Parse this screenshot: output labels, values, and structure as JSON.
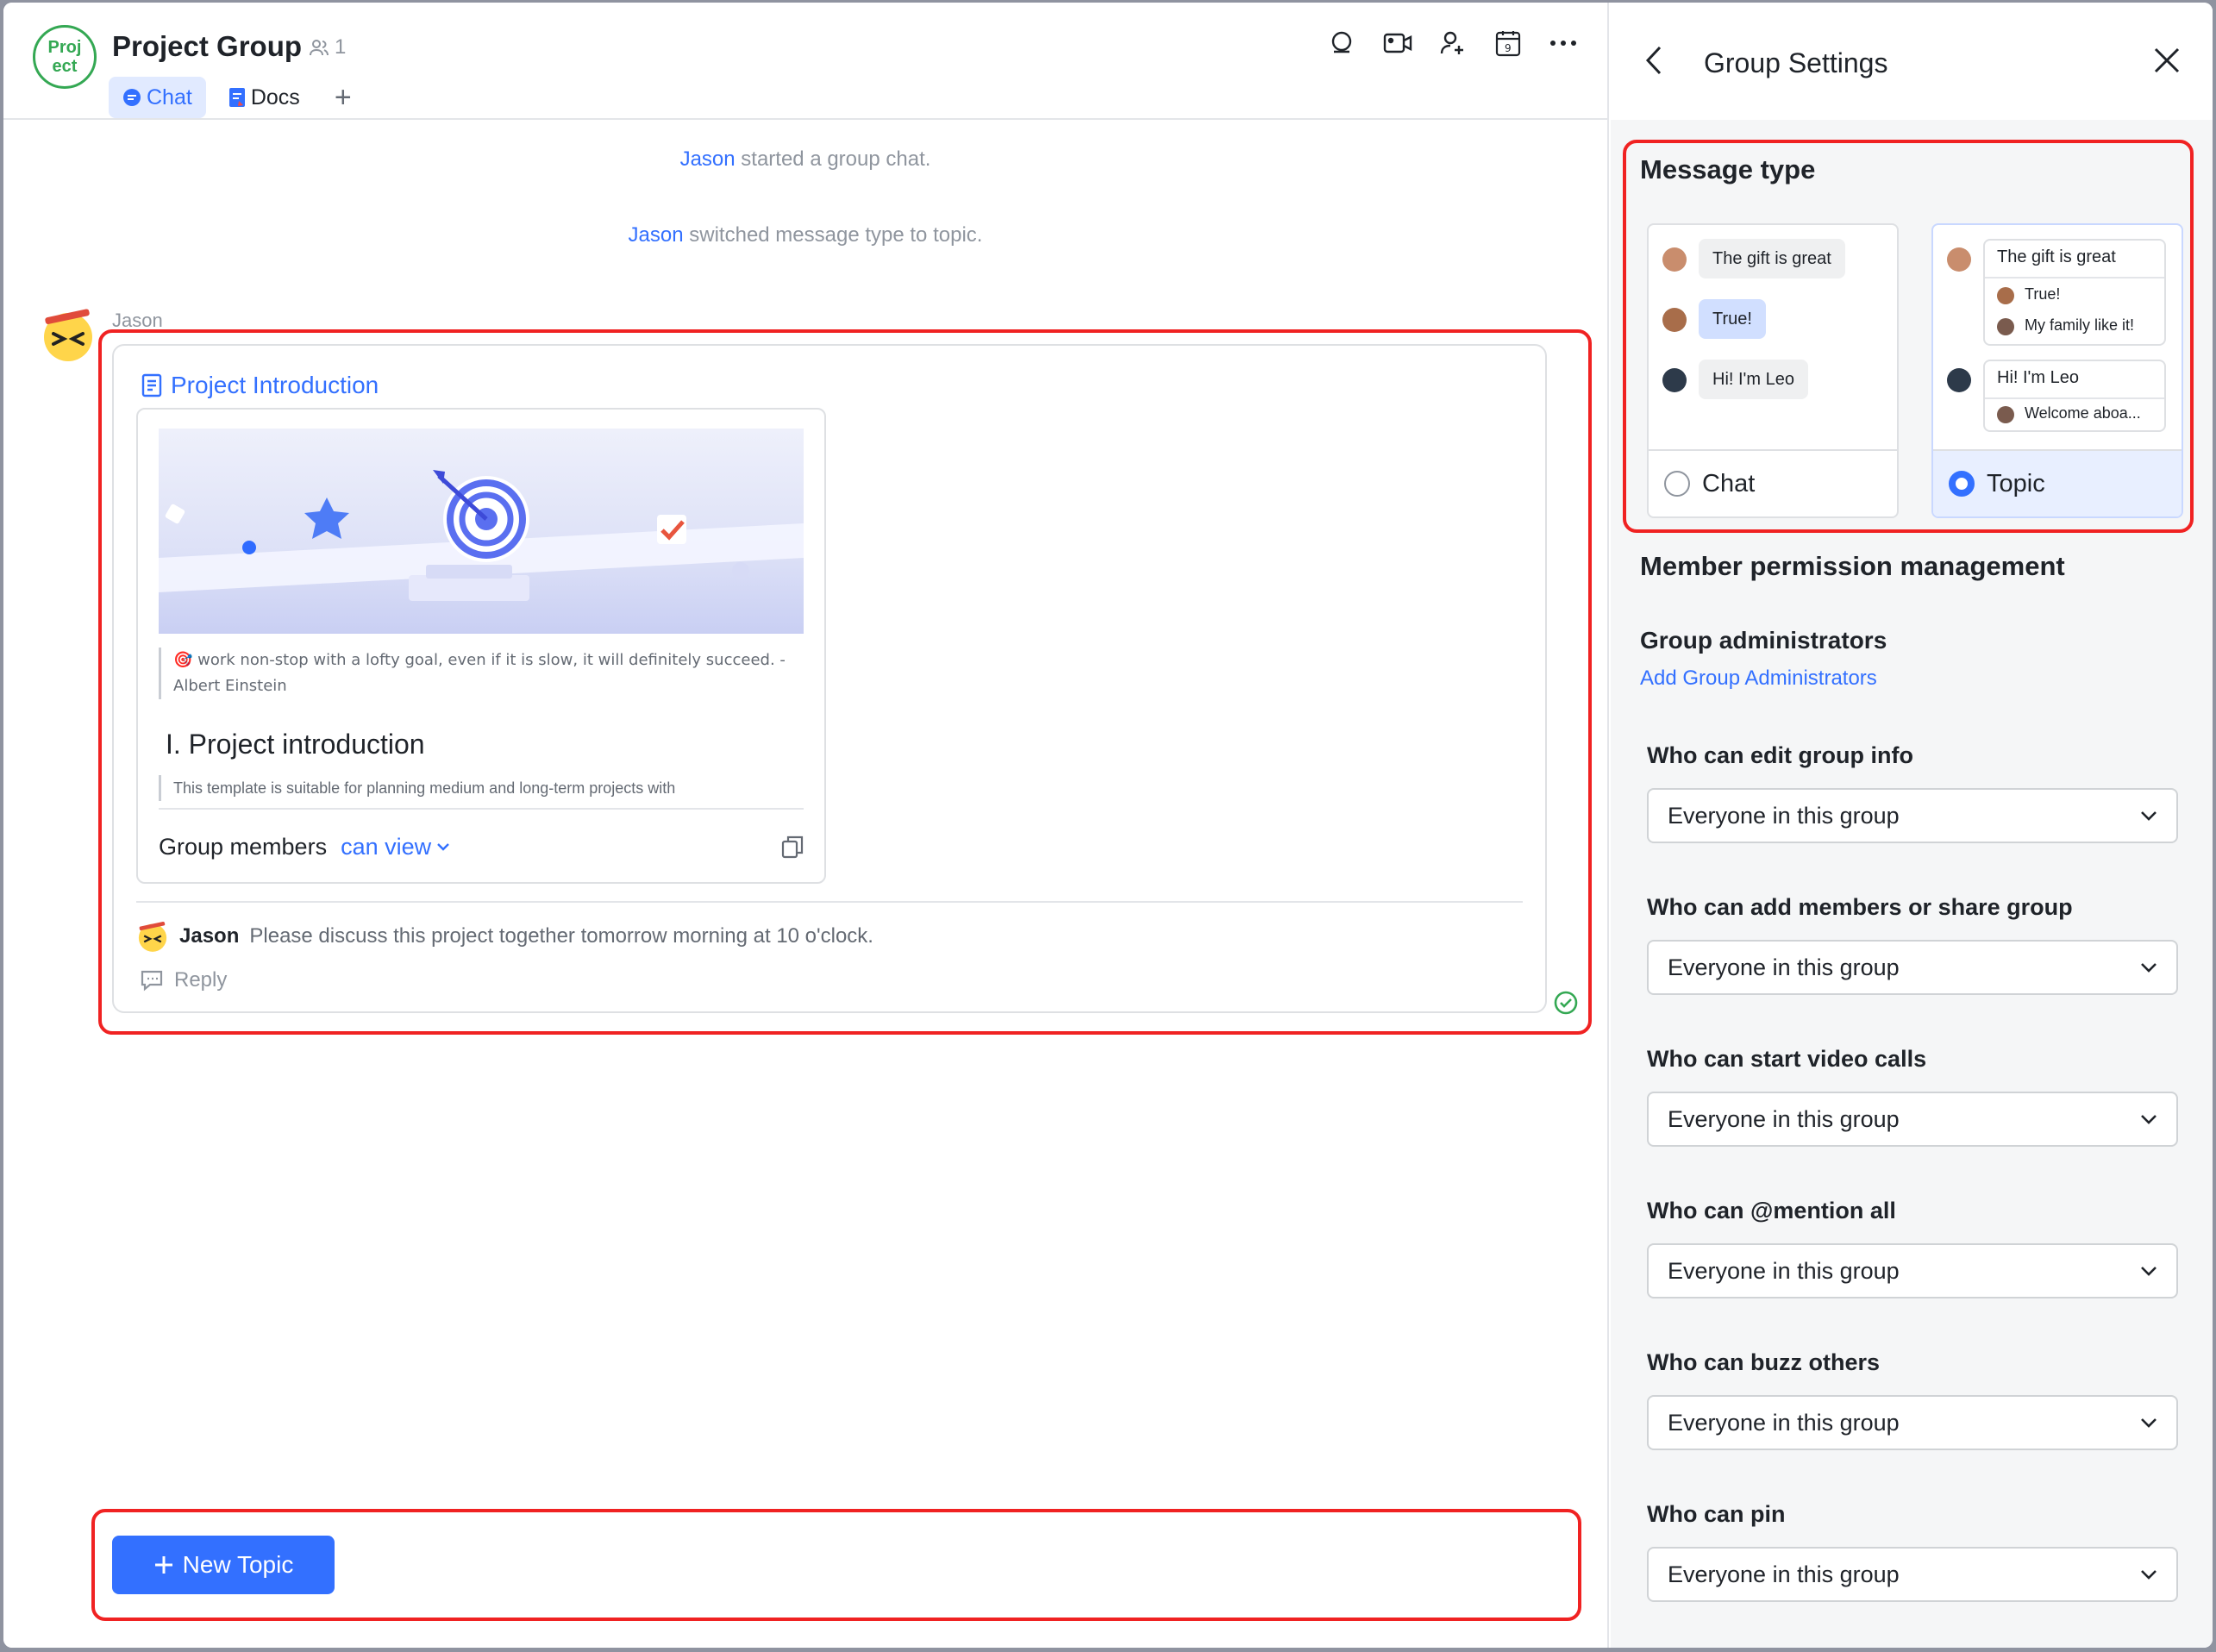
{
  "header": {
    "avatar_text": "Proj\nect",
    "title": "Project Group",
    "member_count": "1",
    "tabs": [
      {
        "label": "Chat",
        "active": true
      },
      {
        "label": "Docs",
        "active": false
      }
    ],
    "icons": [
      "search-icon",
      "video-call-icon",
      "add-member-icon",
      "calendar-icon",
      "more-icon"
    ]
  },
  "system_messages": [
    {
      "name": "Jason",
      "text": "started a group chat."
    },
    {
      "name": "Jason",
      "text": "switched message type to topic."
    }
  ],
  "topic": {
    "sender": "Jason",
    "doc_title": "Project Introduction",
    "doc_quote": "work non-stop with a lofty goal, even if it is slow, it will definitely succeed. - Albert Einstein",
    "doc_heading": "I. Project introduction",
    "doc_body": "This template is suitable for planning medium and long-term projects with",
    "permission_label": "Group members",
    "permission_value": "can view",
    "reply_author": "Jason",
    "reply_text": "Please discuss this project together tomorrow morning at 10 o'clock.",
    "reply_button": "Reply"
  },
  "composer": {
    "new_topic_label": "New Topic"
  },
  "settings": {
    "title": "Group Settings",
    "message_type": {
      "heading": "Message type",
      "chat_option": {
        "label": "Chat",
        "selected": false,
        "bubbles": [
          "The gift is great",
          "True!",
          "Hi! I'm Leo"
        ]
      },
      "topic_option": {
        "label": "Topic",
        "selected": true,
        "thread1_title": "The gift is great",
        "thread1_replies": [
          "True!",
          "My family like it!"
        ],
        "thread2_title": "Hi! I'm Leo",
        "thread2_replies": [
          "Welcome aboa..."
        ]
      }
    },
    "member_permission": {
      "heading": "Member permission management",
      "admins_title": "Group administrators",
      "add_admins_link": "Add Group Administrators",
      "fields": [
        {
          "label": "Who can edit group info",
          "value": "Everyone in this group"
        },
        {
          "label": "Who can add members or share group",
          "value": "Everyone in this group"
        },
        {
          "label": "Who can start video calls",
          "value": "Everyone in this group"
        },
        {
          "label": "Who can @mention all",
          "value": "Everyone in this group"
        },
        {
          "label": "Who can buzz others",
          "value": "Everyone in this group"
        },
        {
          "label": "Who can pin",
          "value": "Everyone in this group"
        }
      ]
    }
  },
  "colors": {
    "accent": "#3370ff",
    "highlight": "#f02222",
    "group_avatar": "#34a853"
  }
}
